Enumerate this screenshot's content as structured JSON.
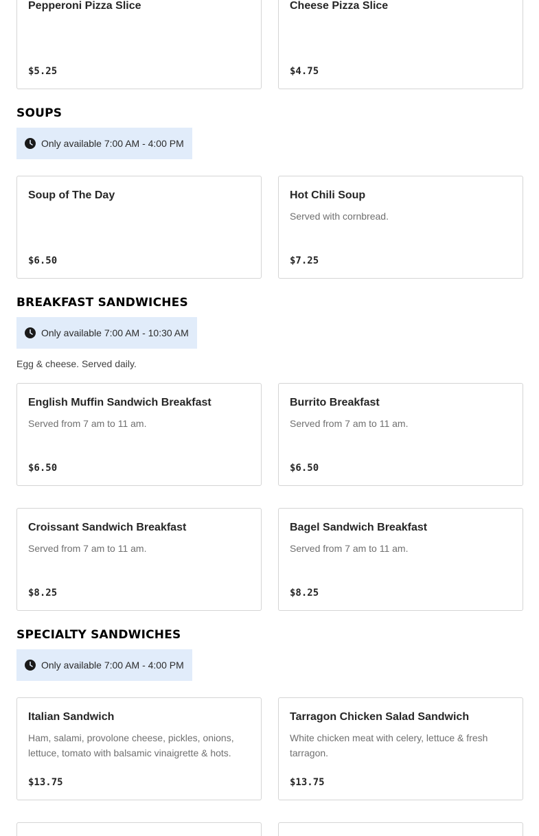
{
  "sections": {
    "pizza": {
      "items": [
        {
          "name": "Pepperoni Pizza Slice",
          "description": "",
          "price": "$5.25"
        },
        {
          "name": "Cheese Pizza Slice",
          "description": "",
          "price": "$4.75"
        }
      ]
    },
    "soups": {
      "title": "SOUPS",
      "availability": "Only available 7:00 AM - 4:00 PM",
      "items": [
        {
          "name": "Soup of The Day",
          "description": "",
          "price": "$6.50"
        },
        {
          "name": "Hot Chili Soup",
          "description": "Served with cornbread.",
          "price": "$7.25"
        }
      ]
    },
    "breakfast": {
      "title": "BREAKFAST SANDWICHES",
      "availability": "Only available 7:00 AM - 10:30 AM",
      "note": "Egg & cheese. Served daily.",
      "items": [
        {
          "name": "English Muffin Sandwich Breakfast",
          "description": "Served from 7 am to 11 am.",
          "price": "$6.50"
        },
        {
          "name": "Burrito Breakfast",
          "description": "Served from 7 am to 11 am.",
          "price": "$6.50"
        },
        {
          "name": "Croissant Sandwich Breakfast",
          "description": "Served from 7 am to 11 am.",
          "price": "$8.25"
        },
        {
          "name": "Bagel Sandwich Breakfast",
          "description": "Served from 7 am to 11 am.",
          "price": "$8.25"
        }
      ]
    },
    "specialty": {
      "title": "SPECIALTY SANDWICHES",
      "availability": "Only available 7:00 AM - 4:00 PM",
      "items": [
        {
          "name": "Italian Sandwich",
          "description": "Ham, salami, provolone cheese, pickles, onions, lettuce, tomato with balsamic vinaigrette & hots.",
          "price": "$13.75"
        },
        {
          "name": "Tarragon Chicken Salad Sandwich",
          "description": "White chicken meat with celery, lettuce & fresh tarragon.",
          "price": "$13.75"
        }
      ]
    }
  },
  "icons": {
    "availability": "clock-icon"
  },
  "colors": {
    "availability_bg": "#e1ecfa",
    "card_border": "#d4d4d4"
  }
}
